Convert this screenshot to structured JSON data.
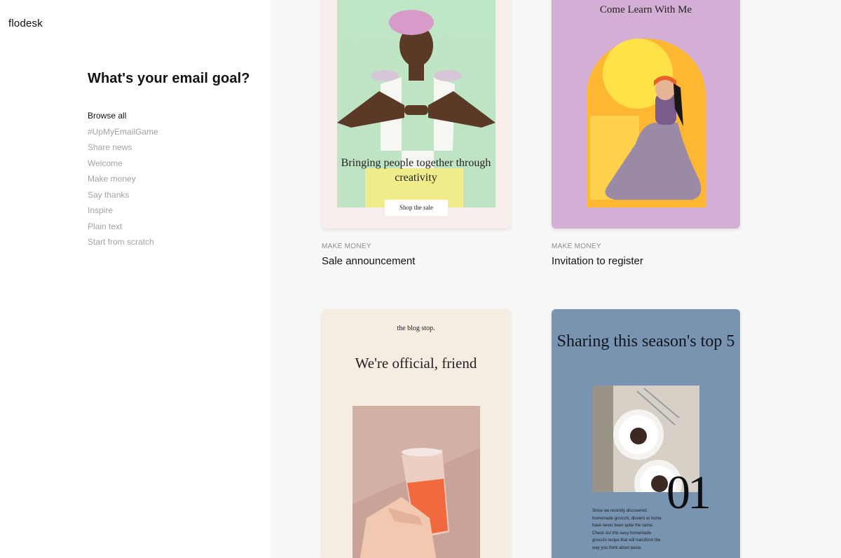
{
  "brand": {
    "logo": "flodesk"
  },
  "sidebar": {
    "title": "What's your email goal?",
    "items": [
      {
        "label": "Browse all",
        "active": true
      },
      {
        "label": "#UpMyEmailGame",
        "active": false
      },
      {
        "label": "Share news",
        "active": false
      },
      {
        "label": "Welcome",
        "active": false
      },
      {
        "label": "Make money",
        "active": false
      },
      {
        "label": "Say thanks",
        "active": false
      },
      {
        "label": "Inspire",
        "active": false
      },
      {
        "label": "Plain text",
        "active": false
      },
      {
        "label": "Start from scratch",
        "active": false
      }
    ]
  },
  "templates": [
    {
      "category": "MAKE MONEY",
      "title": "Sale announcement",
      "preview": {
        "headline": "Bringing people together through creativity",
        "button": "Shop the sale"
      }
    },
    {
      "category": "MAKE MONEY",
      "title": "Invitation to register",
      "preview": {
        "headline": "Come Learn With Me"
      }
    },
    {
      "preview": {
        "brand": "the blog stop.",
        "headline": "We're official, friend"
      }
    },
    {
      "preview": {
        "headline": "Sharing this season's top 5",
        "number": "01",
        "body": "Since we recently discovered homemade gnocchi, dinners at home have never been quite the same. Check out this easy homemade gnocchi recipe that will transform the way you think about pasta."
      }
    }
  ],
  "colors": {
    "sidebar_bg": "#ffffff",
    "main_bg": "#f8f8f8",
    "active_text": "#111111",
    "inactive_text": "#a3a3a3",
    "card1_bg": "#f7eeec",
    "card1_photo": "#bfe6c5",
    "card2_bg": "#d4afd5",
    "card2_photo": "#ffd25a",
    "card3_bg": "#f5ece2",
    "card4_bg": "#7894b1"
  }
}
